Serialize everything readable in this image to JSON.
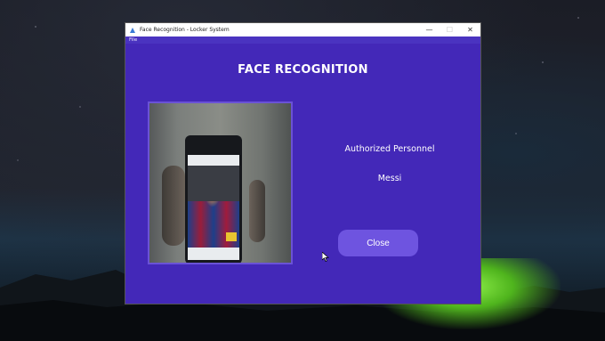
{
  "window": {
    "title": "Face Recognition - Locker System",
    "controls": {
      "minimize": "—",
      "maximize": "☐",
      "close": "✕"
    }
  },
  "menubar": {
    "file_label": "File"
  },
  "main": {
    "heading": "FACE RECOGNITION",
    "status_label": "Authorized Personnel",
    "person_name": "Messi",
    "close_button_label": "Close"
  },
  "colors": {
    "window_bg": "#4328b8",
    "button_bg": "#6e54e0",
    "titlebar_bg": "#ffffff"
  },
  "icons": {
    "app": "app-icon",
    "cursor": "mouse-pointer-icon"
  }
}
